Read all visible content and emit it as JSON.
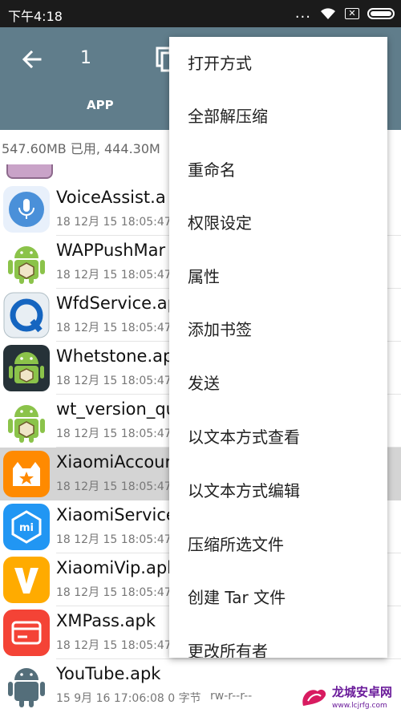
{
  "status_bar": {
    "time": "下午4:18",
    "more": "..."
  },
  "toolbar": {
    "selected_count": "1",
    "tab_label": "APP"
  },
  "storage_info": "547.60MB 已用, 444.30M",
  "files": [
    {
      "name": "VoiceAssist.a",
      "meta": "18 12月 15 18:05:47",
      "icon": "voice-assist-icon"
    },
    {
      "name": "WAPPushMar",
      "meta": "18 12月 15 18:05:47",
      "icon": "android-icon"
    },
    {
      "name": "WfdService.ap",
      "meta": "18 12月 15 18:05:47",
      "icon": "wfd-service-icon"
    },
    {
      "name": "Whetstone.ap",
      "meta": "18 12月 15 18:05:47",
      "icon": "android-icon"
    },
    {
      "name": "wt_version_qu",
      "meta": "18 12月 15 18:05:47",
      "icon": "android-icon"
    },
    {
      "name": "XiaomiAccour",
      "meta": "18 12月 15 18:05:47",
      "icon": "xiaomi-account-icon",
      "selected": true
    },
    {
      "name": "XiaomiService",
      "meta": "18 12月 15 18:05:47",
      "icon": "xiaomi-service-icon"
    },
    {
      "name": "XiaomiVip.apk",
      "meta": "18 12月 15 18:05:47",
      "icon": "xiaomi-vip-icon"
    },
    {
      "name": "XMPass.apk",
      "meta": "18 12月 15 18:05:47",
      "icon": "xmpass-icon"
    },
    {
      "name": "YouTube.apk",
      "meta": "15 9月 16 17:06:08  0 字节",
      "perm": "rw-r--r--",
      "icon": "android-icon"
    }
  ],
  "menu": {
    "items": [
      "打开方式",
      "全部解压缩",
      "重命名",
      "权限设定",
      "属性",
      "添加书签",
      "发送",
      "以文本方式查看",
      "以文本方式编辑",
      "压缩所选文件",
      "创建 Tar 文件",
      "更改所有者"
    ]
  },
  "watermark": {
    "title": "龙城安卓网",
    "url": "www.lcjrfg.com"
  },
  "colors": {
    "appbar": "#607d8b",
    "statusbar": "#1b1b1b",
    "selected_row": "#d4d4d4"
  }
}
